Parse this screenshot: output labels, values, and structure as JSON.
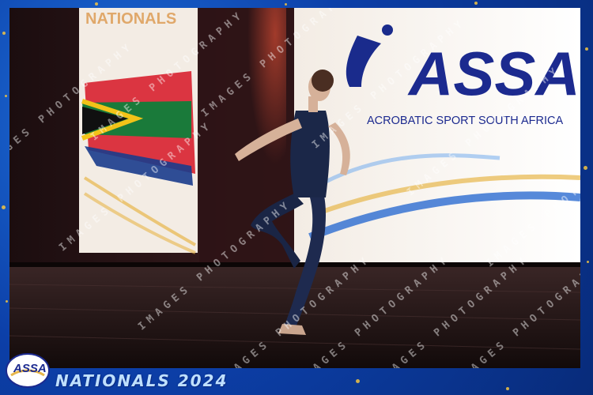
{
  "banner_left": {
    "text": "NATIONALS"
  },
  "banner_right": {
    "logo_text": "ASSA",
    "subtitle": "ACROBATIC SPORT SOUTH AFRICA"
  },
  "watermark": {
    "text": "IMAGES PHOTOGRAPHY"
  },
  "footer": {
    "logo_text": "ASSA",
    "title": "NATIONALS 2024"
  },
  "colors": {
    "frame_blue": "#0c3fa8",
    "gold": "#f4c542",
    "stage_floor": "#2a1a1a",
    "curtain": "#231214"
  }
}
